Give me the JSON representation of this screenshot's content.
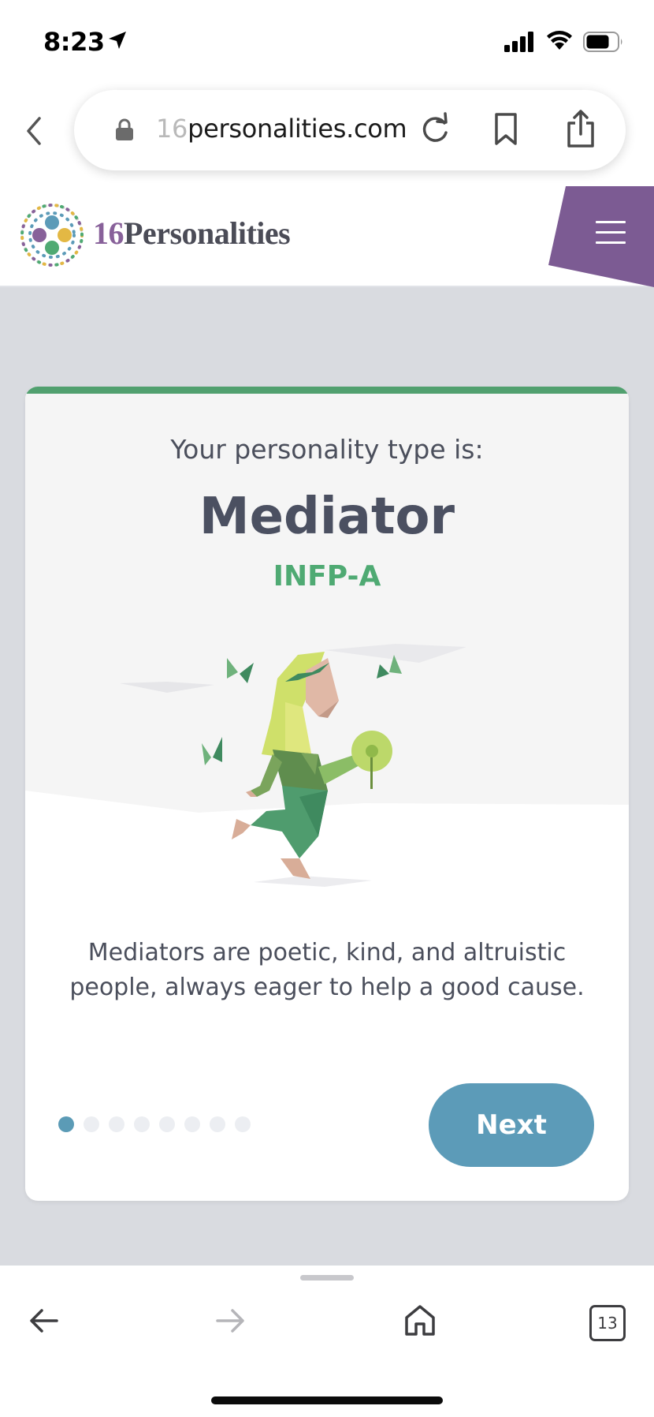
{
  "status_bar": {
    "time": "8:23",
    "location_icon": "location-arrow-icon",
    "signal_icon": "cellular-signal-icon",
    "wifi_icon": "wifi-icon",
    "battery_icon": "battery-icon"
  },
  "browser": {
    "back_icon": "chevron-left-icon",
    "url_faded": "16",
    "url_main": "personalities.com",
    "lock_icon": "lock-icon",
    "reload_icon": "reload-icon",
    "bookmark_icon": "bookmark-icon",
    "share_icon": "share-icon"
  },
  "site_header": {
    "brand_number": "16",
    "brand_name": "Personalities",
    "menu_icon": "hamburger-menu-icon",
    "colors": {
      "brand_purple": "#88619a",
      "menu_tab": "#7c5b93"
    }
  },
  "card": {
    "subtitle": "Your personality type is:",
    "type_name": "Mediator",
    "type_code": "INFP-A",
    "description": "Mediators are poetic, kind, and altruistic people, always eager to help a good cause.",
    "next_label": "Next",
    "pagination": {
      "total": 8,
      "current": 1
    },
    "colors": {
      "accent_green": "#51a06f",
      "next_button": "#5c9bb8"
    }
  },
  "toolbar": {
    "back_icon": "arrow-left-icon",
    "forward_icon": "arrow-right-icon",
    "home_icon": "home-icon",
    "tabs_count": "13"
  }
}
